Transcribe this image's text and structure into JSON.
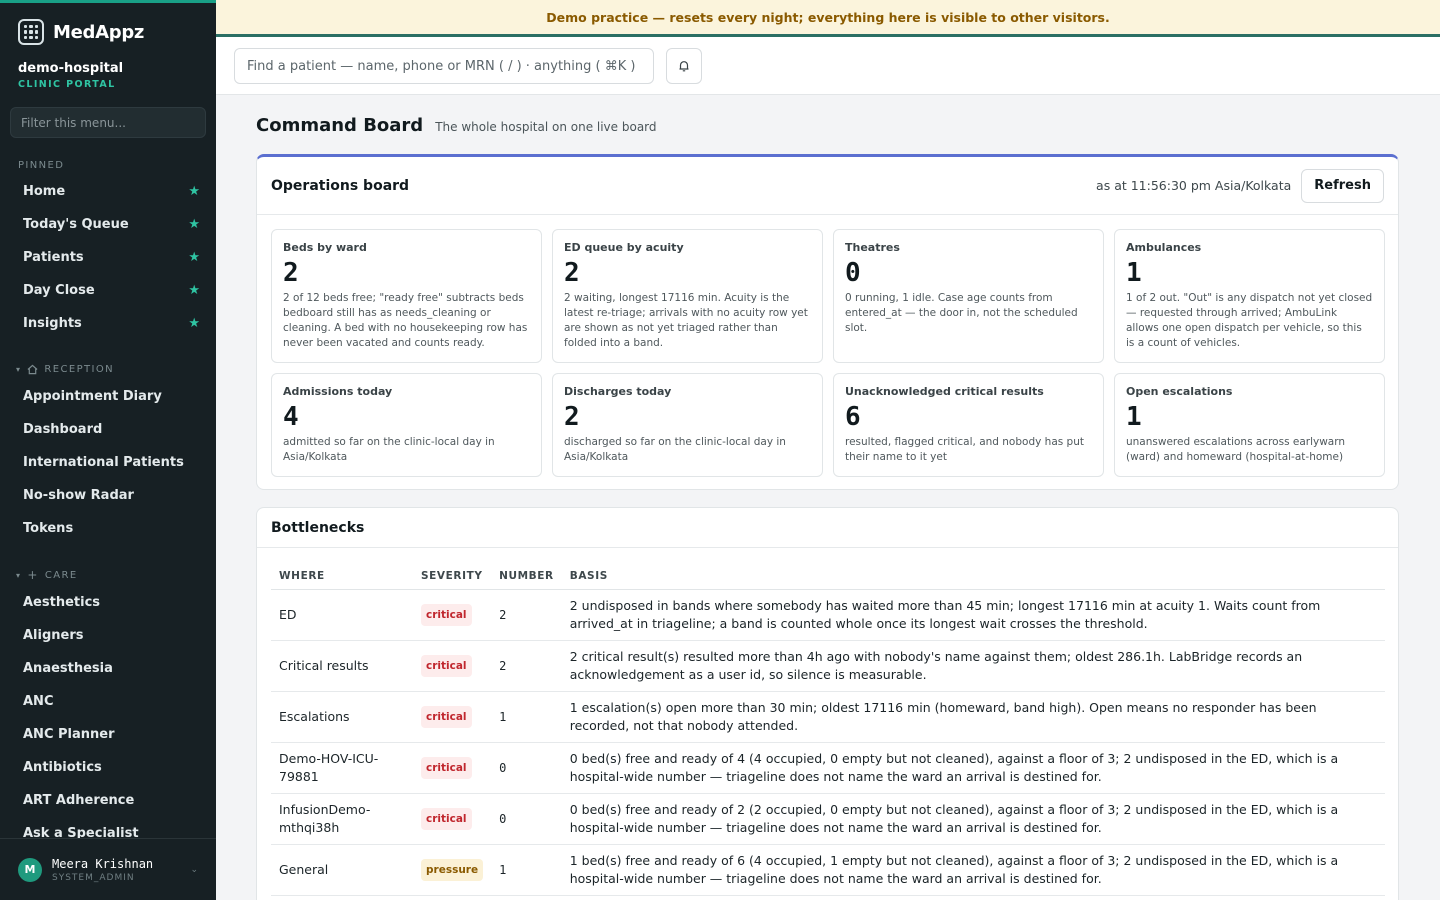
{
  "brand": {
    "name": "MedAppz"
  },
  "org": {
    "name": "demo-hospital",
    "portal": "CLINIC PORTAL"
  },
  "menu_filter": {
    "placeholder": "Filter this menu..."
  },
  "pinned": {
    "label": "PINNED",
    "items": [
      {
        "label": "Home"
      },
      {
        "label": "Today's Queue"
      },
      {
        "label": "Patients"
      },
      {
        "label": "Day Close"
      },
      {
        "label": "Insights"
      }
    ]
  },
  "reception": {
    "label": "RECEPTION",
    "items": [
      {
        "label": "Appointment Diary"
      },
      {
        "label": "Dashboard"
      },
      {
        "label": "International Patients"
      },
      {
        "label": "No-show Radar"
      },
      {
        "label": "Tokens"
      }
    ]
  },
  "care": {
    "label": "CARE",
    "items": [
      {
        "label": "Aesthetics"
      },
      {
        "label": "Aligners"
      },
      {
        "label": "Anaesthesia"
      },
      {
        "label": "ANC"
      },
      {
        "label": "ANC Planner"
      },
      {
        "label": "Antibiotics"
      },
      {
        "label": "ART Adherence"
      },
      {
        "label": "Ask a Specialist"
      }
    ]
  },
  "user": {
    "initial": "M",
    "name": "Meera Krishnan",
    "role": "SYSTEM_ADMIN"
  },
  "banner": {
    "text": "Demo practice — resets every night; everything here is visible to other visitors."
  },
  "search": {
    "placeholder": "Find a patient — name, phone or MRN ( / ) · anything ( ⌘K )"
  },
  "page": {
    "title": "Command Board",
    "subtitle": "The whole hospital on one live board"
  },
  "operations": {
    "title": "Operations board",
    "as_at": "as at 11:56:30 pm Asia/Kolkata",
    "refresh_label": "Refresh",
    "tiles": [
      {
        "label": "Beds by ward",
        "value": "2",
        "desc": "2 of 12 beds free; \"ready free\" subtracts beds bedboard still has as needs_cleaning or cleaning. A bed with no housekeeping row has never been vacated and counts ready."
      },
      {
        "label": "ED queue by acuity",
        "value": "2",
        "desc": "2 waiting, longest 17116 min. Acuity is the latest re-triage; arrivals with no acuity row yet are shown as not yet triaged rather than folded into a band."
      },
      {
        "label": "Theatres",
        "value": "0",
        "desc": "0 running, 1 idle. Case age counts from entered_at — the door in, not the scheduled slot."
      },
      {
        "label": "Ambulances",
        "value": "1",
        "desc": "1 of 2 out. \"Out\" is any dispatch not yet closed — requested through arrived; AmbuLink allows one open dispatch per vehicle, so this is a count of vehicles."
      },
      {
        "label": "Admissions today",
        "value": "4",
        "desc": "admitted so far on the clinic-local day in Asia/Kolkata"
      },
      {
        "label": "Discharges today",
        "value": "2",
        "desc": "discharged so far on the clinic-local day in Asia/Kolkata"
      },
      {
        "label": "Unacknowledged critical results",
        "value": "6",
        "desc": "resulted, flagged critical, and nobody has put their name to it yet"
      },
      {
        "label": "Open escalations",
        "value": "1",
        "desc": "unanswered escalations across earlywarn (ward) and homeward (hospital-at-home)"
      }
    ]
  },
  "bottlenecks": {
    "title": "Bottlenecks",
    "columns": [
      "WHERE",
      "SEVERITY",
      "NUMBER",
      "BASIS"
    ],
    "rows": [
      {
        "where": "ED",
        "severity": "critical",
        "number": "2",
        "basis": "2 undisposed in bands where somebody has waited more than 45 min; longest 17116 min at acuity 1. Waits count from arrived_at in triageline; a band is counted whole once its longest wait crosses the threshold."
      },
      {
        "where": "Critical results",
        "severity": "critical",
        "number": "2",
        "basis": "2 critical result(s) resulted more than 4h ago with nobody's name against them; oldest 286.1h. LabBridge records an acknowledgement as a user id, so silence is measurable."
      },
      {
        "where": "Escalations",
        "severity": "critical",
        "number": "1",
        "basis": "1 escalation(s) open more than 30 min; oldest 17116 min (homeward, band high). Open means no responder has been recorded, not that nobody attended."
      },
      {
        "where": "Demo-HOV-ICU-79881",
        "severity": "critical",
        "number": "0",
        "basis": "0 bed(s) free and ready of 4 (4 occupied, 0 empty but not cleaned), against a floor of 3; 2 undisposed in the ED, which is a hospital-wide number — triageline does not name the ward an arrival is destined for."
      },
      {
        "where": "InfusionDemo-mthqi38h",
        "severity": "critical",
        "number": "0",
        "basis": "0 bed(s) free and ready of 2 (2 occupied, 0 empty but not cleaned), against a floor of 3; 2 undisposed in the ED, which is a hospital-wide number — triageline does not name the ward an arrival is destined for."
      },
      {
        "where": "General",
        "severity": "pressure",
        "number": "1",
        "basis": "1 bed(s) free and ready of 6 (4 occupied, 1 empty but not cleaned), against a floor of 3; 2 undisposed in the ED, which is a hospital-wide number — triageline does not name the ward an arrival is destined for."
      }
    ]
  }
}
